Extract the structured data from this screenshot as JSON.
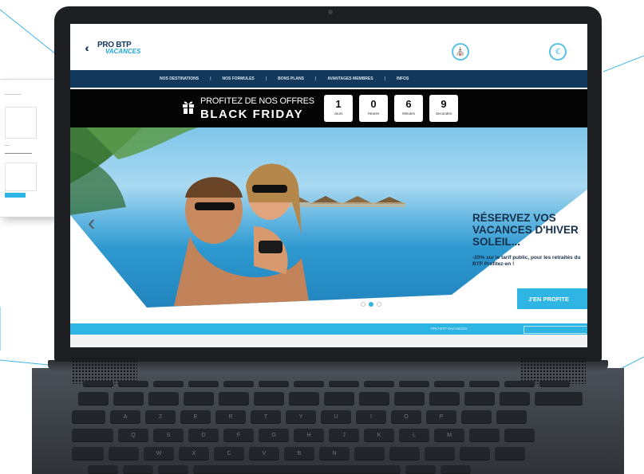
{
  "colors": {
    "navy": "#13395c",
    "accent": "#2fb5e3",
    "black_banner": "#050505",
    "bezel": "#1d1f22"
  },
  "logo": {
    "line1": "PRO BTP",
    "line2": "VACANCES"
  },
  "header": {
    "icon1": "rental-icon",
    "icon1_label": "",
    "icon2": "euro-icon",
    "icon2_label": ""
  },
  "nav": {
    "items": [
      {
        "label": "NOS DESTINATIONS"
      },
      {
        "label": "NOS FORMULES"
      },
      {
        "label": "BONS PLANS"
      },
      {
        "label": "AVANTAGES MEMBRES"
      },
      {
        "label": "INFOS"
      }
    ]
  },
  "promo": {
    "line1": "PROFITEZ DE NOS OFFRES",
    "line2": "BLACK FRIDAY",
    "countdown": [
      {
        "value": "1",
        "unit": "Jours"
      },
      {
        "value": "0",
        "unit": "Heures"
      },
      {
        "value": "6",
        "unit": "Minutes"
      },
      {
        "value": "9",
        "unit": "Secondes"
      }
    ]
  },
  "hero": {
    "title": "RÉSERVEZ VOS VACANCES D'HIVER SOLEIL...",
    "subtitle": "-20% sur le tarif public, pour les retraités du BTP Profitez-en !",
    "cta": "J'EN PROFITE",
    "slides_total": 3,
    "slide_active": 2
  },
  "bottom_bar": {
    "label": "PRO BTP VACANCES"
  },
  "keyboard": {
    "row2": [
      "A",
      "Z",
      "E",
      "R",
      "T",
      "Y",
      "U",
      "I",
      "O",
      "P"
    ],
    "row3": [
      "Q",
      "S",
      "D",
      "F",
      "G",
      "H",
      "J",
      "K",
      "L",
      "M"
    ],
    "row4": [
      "W",
      "X",
      "C",
      "V",
      "B",
      "N"
    ]
  }
}
